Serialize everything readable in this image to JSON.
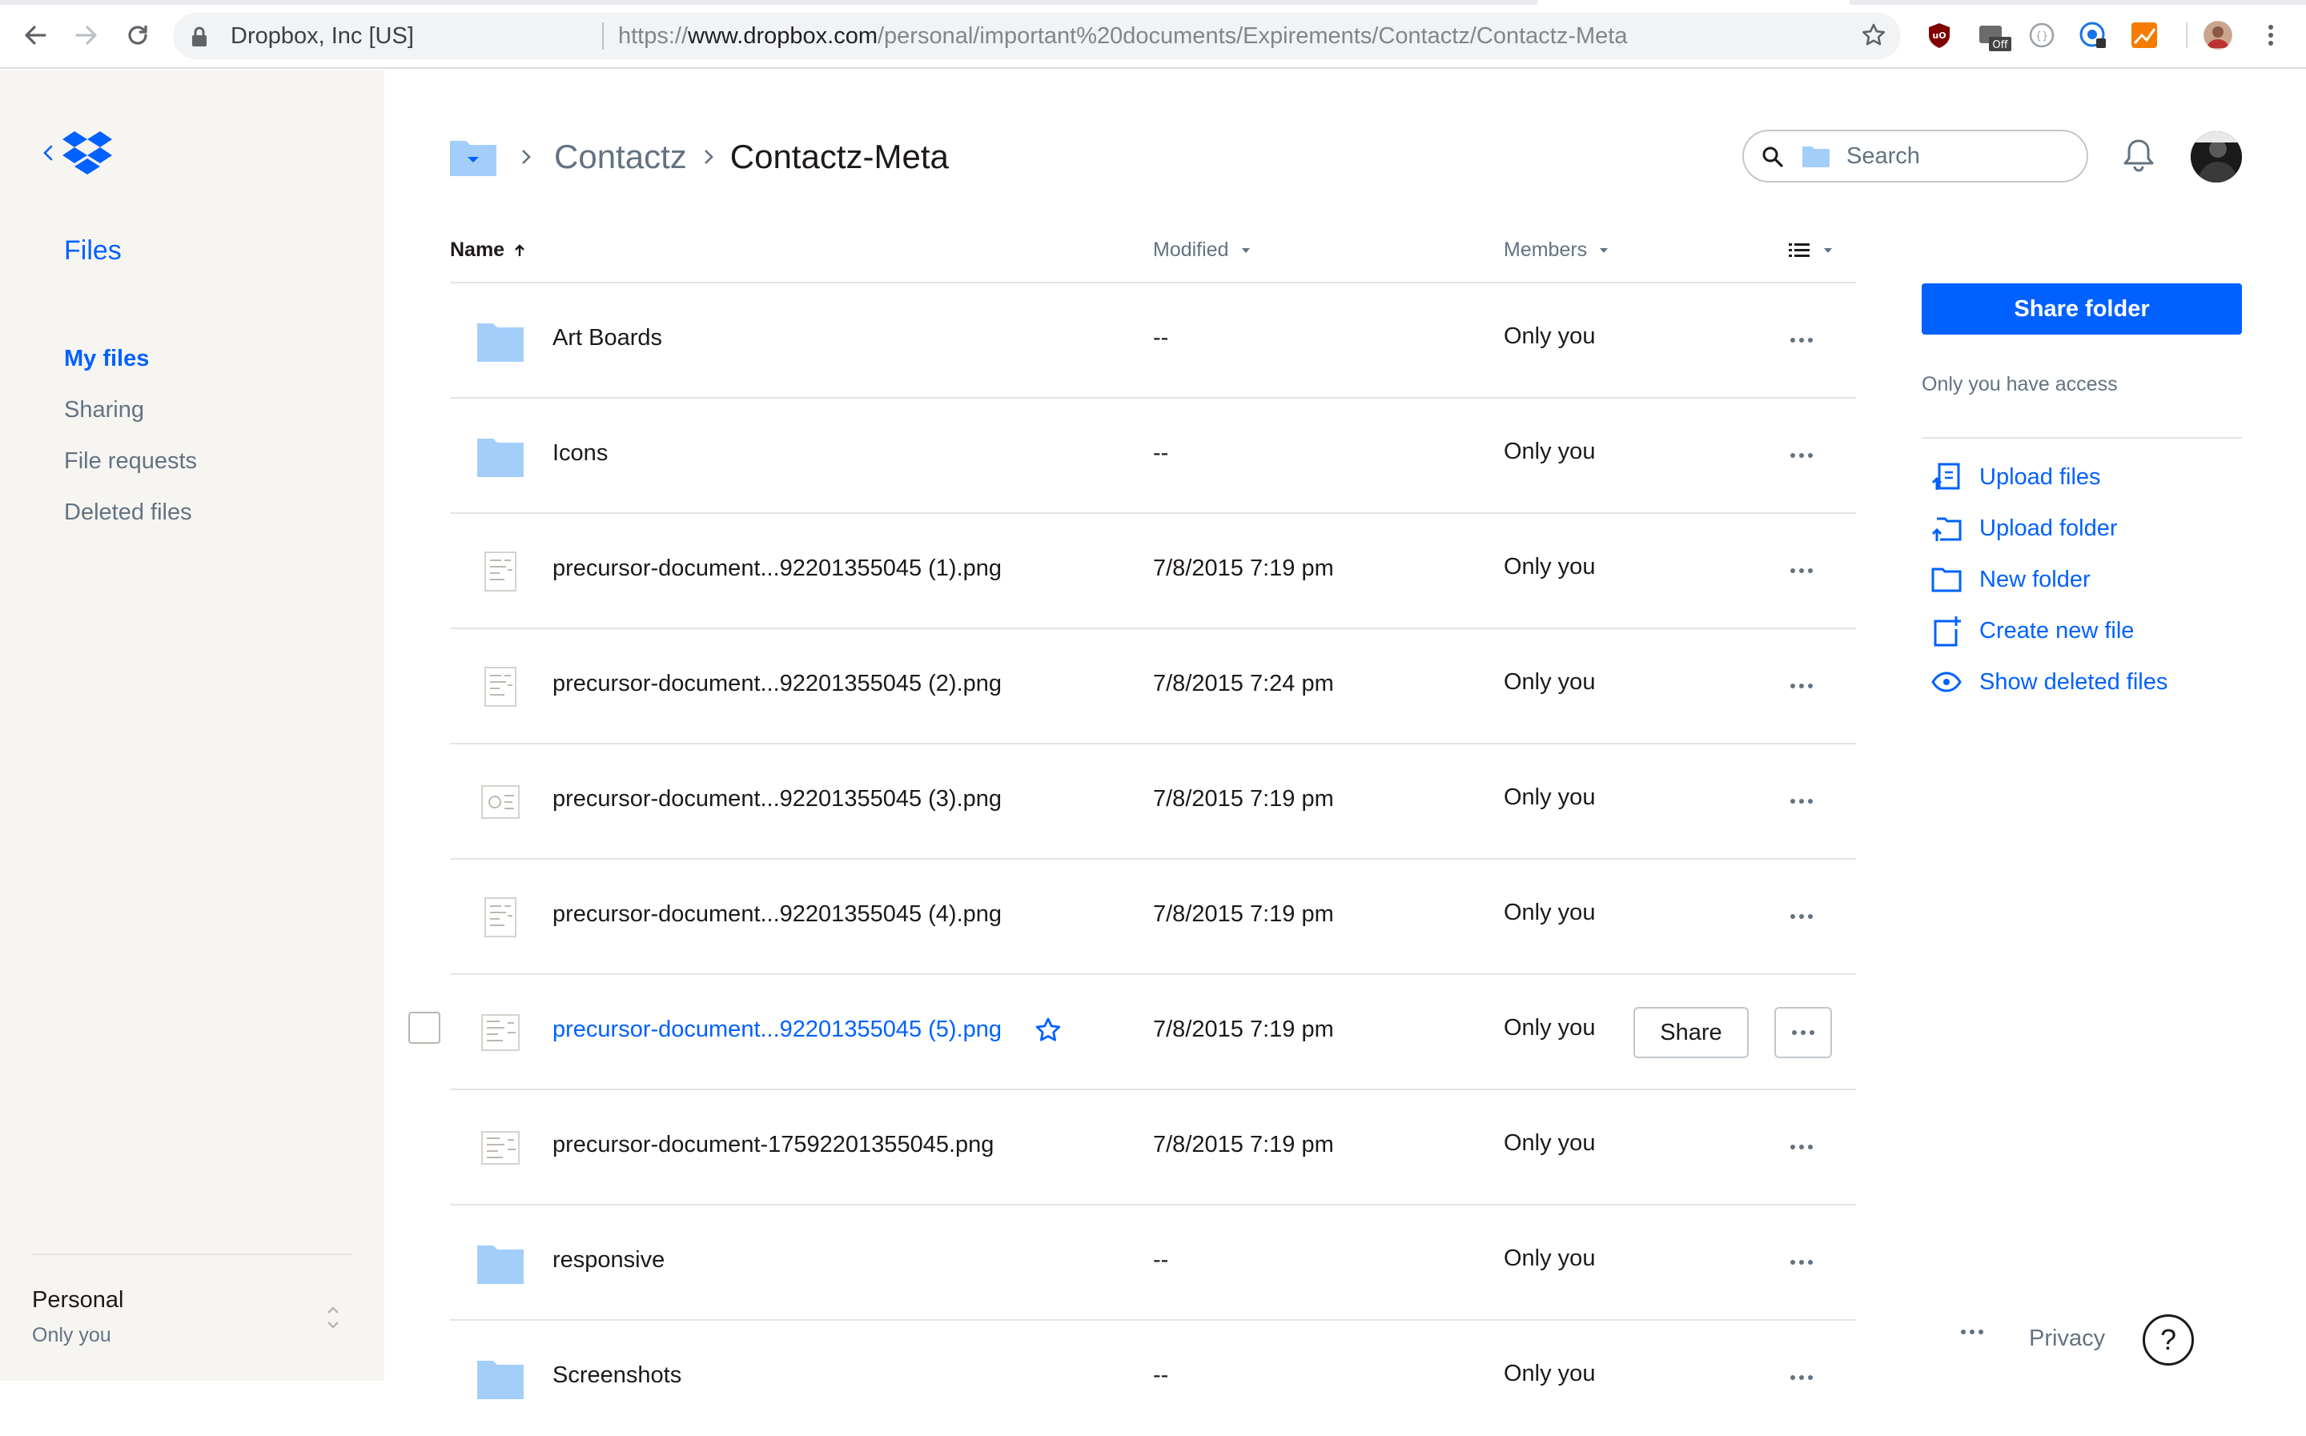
{
  "browser": {
    "site_label": "Dropbox, Inc [US]",
    "url_prefix": "https://",
    "url_host": "www.dropbox.com",
    "url_path": "/personal/important%20documents/Expirements/Contactz/Contactz-Meta",
    "extension_badge": "Off"
  },
  "sidebar": {
    "title": "Files",
    "items": [
      {
        "label": "My files",
        "active": true
      },
      {
        "label": "Sharing"
      },
      {
        "label": "File requests"
      },
      {
        "label": "Deleted files"
      }
    ],
    "account": {
      "name": "Personal",
      "sub": "Only you"
    }
  },
  "header": {
    "breadcrumb": [
      "Contactz",
      "Contactz-Meta"
    ],
    "search_placeholder": "Search"
  },
  "table": {
    "columns": {
      "name": "Name",
      "modified": "Modified",
      "members": "Members"
    },
    "rows": [
      {
        "type": "folder",
        "name": "Art Boards",
        "modified": "--",
        "members": "Only you"
      },
      {
        "type": "folder",
        "name": "Icons",
        "modified": "--",
        "members": "Only you"
      },
      {
        "type": "image",
        "name": "precursor-document...92201355045 (1).png",
        "modified": "7/8/2015 7:19 pm",
        "members": "Only you"
      },
      {
        "type": "image",
        "name": "precursor-document...92201355045 (2).png",
        "modified": "7/8/2015 7:24 pm",
        "members": "Only you"
      },
      {
        "type": "image",
        "name": "precursor-document...92201355045 (3).png",
        "modified": "7/8/2015 7:19 pm",
        "members": "Only you"
      },
      {
        "type": "image",
        "name": "precursor-document...92201355045 (4).png",
        "modified": "7/8/2015 7:19 pm",
        "members": "Only you"
      },
      {
        "type": "image",
        "name": "precursor-document...92201355045 (5).png",
        "modified": "7/8/2015 7:19 pm",
        "members": "Only you",
        "hovered": true,
        "share_label": "Share"
      },
      {
        "type": "image",
        "name": "precursor-document-17592201355045.png",
        "modified": "7/8/2015 7:19 pm",
        "members": "Only you"
      },
      {
        "type": "folder",
        "name": "responsive",
        "modified": "--",
        "members": "Only you"
      },
      {
        "type": "folder",
        "name": "Screenshots",
        "modified": "--",
        "members": "Only you"
      }
    ]
  },
  "right_panel": {
    "share_folder_label": "Share folder",
    "access_text": "Only you have access",
    "actions": [
      {
        "label": "Upload files",
        "icon": "upload-files-icon"
      },
      {
        "label": "Upload folder",
        "icon": "upload-folder-icon"
      },
      {
        "label": "New folder",
        "icon": "new-folder-icon"
      },
      {
        "label": "Create new file",
        "icon": "create-file-icon"
      },
      {
        "label": "Show deleted files",
        "icon": "eye-icon"
      }
    ]
  },
  "footer": {
    "privacy_label": "Privacy",
    "help_label": "?"
  },
  "colors": {
    "accent": "#0061fe",
    "folder": "#a3cefa",
    "sidebar_bg": "#f7f5f2"
  }
}
